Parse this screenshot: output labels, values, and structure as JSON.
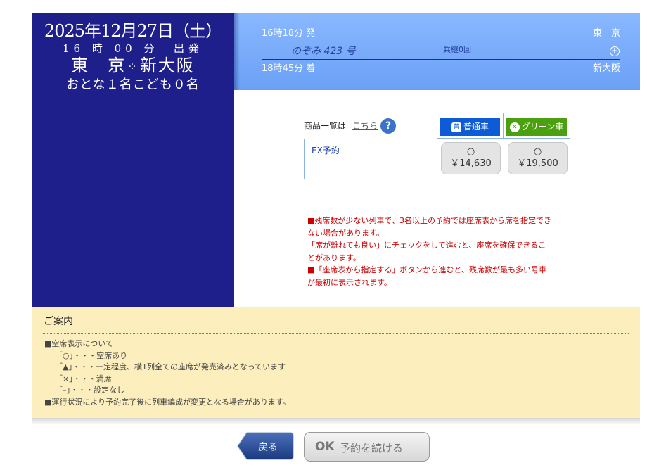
{
  "summary": {
    "date": "2025年12月27日（土）",
    "hour": "16",
    "hour_unit": "時",
    "minute": "00",
    "minute_unit": "分",
    "depart_word": "出発",
    "from": "東　京",
    "to": "新大阪",
    "passengers": "おとな１名こども０名"
  },
  "header": {
    "depart_time": "16時18分 発",
    "depart_station": "東　京",
    "train": "のぞみ 423 号",
    "transfer": "乗継0回",
    "arrive_time": "18時45分 着",
    "arrive_station": "新大阪"
  },
  "fares": {
    "list_label": "商品一覧は",
    "list_link": "こちら",
    "help": "?",
    "classes": [
      {
        "label": "普通車",
        "icon": "普",
        "color": "#0d5bd7"
      },
      {
        "label": "グリーン車",
        "icon": "✕",
        "color": "#4aa00e"
      }
    ],
    "product": "EX予約",
    "seats": [
      {
        "symbol": "○",
        "price": "￥14,630"
      },
      {
        "symbol": "○",
        "price": "￥19,500"
      }
    ]
  },
  "notice": {
    "lines": [
      "■残席数が少ない列車で、3名以上の予約では座席表から席を指定でき",
      "ない場合があります。",
      "「席が離れても良い」にチェックをして進むと、座席を確保できるこ",
      "とがあります。",
      "■「座席表から指定する」ボタンから進むと、残席数が最も多い号車",
      "が最初に表示されます。"
    ]
  },
  "guide": {
    "title": "ご案内",
    "lines": [
      "■空席表示について",
      "「○」・・・空席あり",
      "「▲」・・・一定程度、横1列全ての座席が発売済みとなっています",
      "「×」・・・満席",
      "「–」・・・設定なし",
      "■運行状況により予約完了後に列車編成が変更となる場合があります。"
    ]
  },
  "buttons": {
    "back": "戻る",
    "ok_mark": "OK",
    "continue": "予約を続ける"
  }
}
